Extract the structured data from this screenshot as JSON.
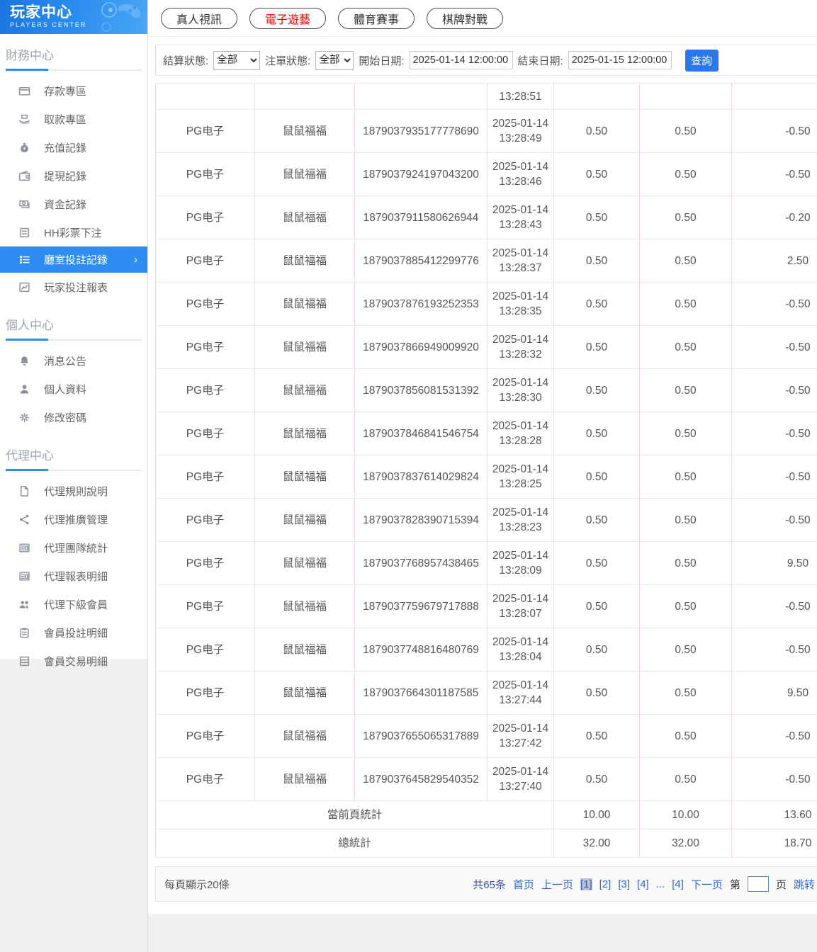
{
  "app": {
    "title": "玩家中心",
    "subtitle": "PLAYERS CENTER"
  },
  "sidebar": {
    "sections": [
      {
        "label": "財務中心",
        "items": [
          {
            "label": "存款專區",
            "icon": "deposit-card-icon"
          },
          {
            "label": "取款專區",
            "icon": "withdraw-hand-icon"
          },
          {
            "label": "充值記錄",
            "icon": "recharge-bag-icon"
          },
          {
            "label": "提現記錄",
            "icon": "withdrawal-wallet-icon"
          },
          {
            "label": "資金記錄",
            "icon": "funds-money-icon"
          },
          {
            "label": "HH彩票下注",
            "icon": "lottery-doc-icon"
          },
          {
            "label": "廳室投註記錄",
            "icon": "room-bet-list-icon",
            "active": true
          },
          {
            "label": "玩家投注報表",
            "icon": "player-report-chart-icon"
          }
        ]
      },
      {
        "label": "個人中心",
        "items": [
          {
            "label": "消息公告",
            "icon": "announcement-bell-icon"
          },
          {
            "label": "個人資料",
            "icon": "profile-user-icon"
          },
          {
            "label": "修改密碼",
            "icon": "password-gear-icon"
          }
        ]
      },
      {
        "label": "代理中心",
        "items": [
          {
            "label": "代理規則說明",
            "icon": "agent-rules-file-icon"
          },
          {
            "label": "代理推廣管理",
            "icon": "agent-promo-share-icon"
          },
          {
            "label": "代理團隊統計",
            "icon": "agent-team-news-icon"
          },
          {
            "label": "代理報表明細",
            "icon": "agent-report-news-icon"
          },
          {
            "label": "代理下級會員",
            "icon": "agent-members-users-icon"
          },
          {
            "label": "會員投註明細",
            "icon": "member-bet-clipboard-icon"
          },
          {
            "label": "會員交易明細",
            "icon": "member-transaction-rows-icon"
          }
        ]
      }
    ]
  },
  "tabs": [
    {
      "label": "真人視訊"
    },
    {
      "label": "電子遊藝",
      "active": true
    },
    {
      "label": "體育賽事"
    },
    {
      "label": "棋牌對戰"
    }
  ],
  "filters": {
    "settlement_label": "結算狀態:",
    "settlement_value": "全部",
    "order_label": "注單狀態:",
    "order_value": "全部",
    "start_label": "開始日期:",
    "start_value": "2025-01-14 12:00:00",
    "end_label": "結束日期:",
    "end_value": "2025-01-15 12:00:00",
    "search_label": "查詢"
  },
  "table": {
    "partial_row_time": "13:28:51",
    "rows": [
      {
        "platform": "PG电子",
        "game": "鼠鼠福福",
        "order_id": "1879037935177778690",
        "date": "2025-01-14",
        "time": "13:28:49",
        "bet": "0.50",
        "valid_bet": "0.50",
        "win_loss": "-0.50"
      },
      {
        "platform": "PG电子",
        "game": "鼠鼠福福",
        "order_id": "1879037924197043200",
        "date": "2025-01-14",
        "time": "13:28:46",
        "bet": "0.50",
        "valid_bet": "0.50",
        "win_loss": "-0.50"
      },
      {
        "platform": "PG电子",
        "game": "鼠鼠福福",
        "order_id": "1879037911580626944",
        "date": "2025-01-14",
        "time": "13:28:43",
        "bet": "0.50",
        "valid_bet": "0.50",
        "win_loss": "-0.20"
      },
      {
        "platform": "PG电子",
        "game": "鼠鼠福福",
        "order_id": "1879037885412299776",
        "date": "2025-01-14",
        "time": "13:28:37",
        "bet": "0.50",
        "valid_bet": "0.50",
        "win_loss": "2.50"
      },
      {
        "platform": "PG电子",
        "game": "鼠鼠福福",
        "order_id": "1879037876193252353",
        "date": "2025-01-14",
        "time": "13:28:35",
        "bet": "0.50",
        "valid_bet": "0.50",
        "win_loss": "-0.50"
      },
      {
        "platform": "PG电子",
        "game": "鼠鼠福福",
        "order_id": "1879037866949009920",
        "date": "2025-01-14",
        "time": "13:28:32",
        "bet": "0.50",
        "valid_bet": "0.50",
        "win_loss": "-0.50"
      },
      {
        "platform": "PG电子",
        "game": "鼠鼠福福",
        "order_id": "1879037856081531392",
        "date": "2025-01-14",
        "time": "13:28:30",
        "bet": "0.50",
        "valid_bet": "0.50",
        "win_loss": "-0.50"
      },
      {
        "platform": "PG电子",
        "game": "鼠鼠福福",
        "order_id": "1879037846841546754",
        "date": "2025-01-14",
        "time": "13:28:28",
        "bet": "0.50",
        "valid_bet": "0.50",
        "win_loss": "-0.50"
      },
      {
        "platform": "PG电子",
        "game": "鼠鼠福福",
        "order_id": "1879037837614029824",
        "date": "2025-01-14",
        "time": "13:28:25",
        "bet": "0.50",
        "valid_bet": "0.50",
        "win_loss": "-0.50"
      },
      {
        "platform": "PG电子",
        "game": "鼠鼠福福",
        "order_id": "1879037828390715394",
        "date": "2025-01-14",
        "time": "13:28:23",
        "bet": "0.50",
        "valid_bet": "0.50",
        "win_loss": "-0.50"
      },
      {
        "platform": "PG电子",
        "game": "鼠鼠福福",
        "order_id": "1879037768957438465",
        "date": "2025-01-14",
        "time": "13:28:09",
        "bet": "0.50",
        "valid_bet": "0.50",
        "win_loss": "9.50"
      },
      {
        "platform": "PG电子",
        "game": "鼠鼠福福",
        "order_id": "1879037759679717888",
        "date": "2025-01-14",
        "time": "13:28:07",
        "bet": "0.50",
        "valid_bet": "0.50",
        "win_loss": "-0.50"
      },
      {
        "platform": "PG电子",
        "game": "鼠鼠福福",
        "order_id": "1879037748816480769",
        "date": "2025-01-14",
        "time": "13:28:04",
        "bet": "0.50",
        "valid_bet": "0.50",
        "win_loss": "-0.50"
      },
      {
        "platform": "PG电子",
        "game": "鼠鼠福福",
        "order_id": "1879037664301187585",
        "date": "2025-01-14",
        "time": "13:27:44",
        "bet": "0.50",
        "valid_bet": "0.50",
        "win_loss": "9.50"
      },
      {
        "platform": "PG电子",
        "game": "鼠鼠福福",
        "order_id": "1879037655065317889",
        "date": "2025-01-14",
        "time": "13:27:42",
        "bet": "0.50",
        "valid_bet": "0.50",
        "win_loss": "-0.50"
      },
      {
        "platform": "PG电子",
        "game": "鼠鼠福福",
        "order_id": "1879037645829540352",
        "date": "2025-01-14",
        "time": "13:27:40",
        "bet": "0.50",
        "valid_bet": "0.50",
        "win_loss": "-0.50"
      }
    ],
    "page_summary": {
      "label": "當前頁統計",
      "bet": "10.00",
      "valid_bet": "10.00",
      "win_loss": "13.60"
    },
    "total_summary": {
      "label": "總統計",
      "bet": "32.00",
      "valid_bet": "32.00",
      "win_loss": "18.70"
    }
  },
  "footer": {
    "page_size_text": "每頁顯示20條",
    "total_count_text": "共65条",
    "first_page": "首页",
    "prev_page": "上一页",
    "pages": [
      {
        "text": "[1]",
        "active": true
      },
      {
        "text": "[2]"
      },
      {
        "text": "[3]"
      },
      {
        "text": "[4]"
      },
      {
        "text": "..."
      },
      {
        "text": "[4]"
      }
    ],
    "next_page": "下一页",
    "jump_prefix": "第",
    "jump_suffix": "页",
    "jump_action": "跳转"
  },
  "colors": {
    "accent_blue": "#2e8df2",
    "active_tab_red": "#f10000",
    "button_blue": "#2979e8",
    "table_border_vertical": "#f6d8d8",
    "table_border_horizontal": "#eaeaea"
  }
}
